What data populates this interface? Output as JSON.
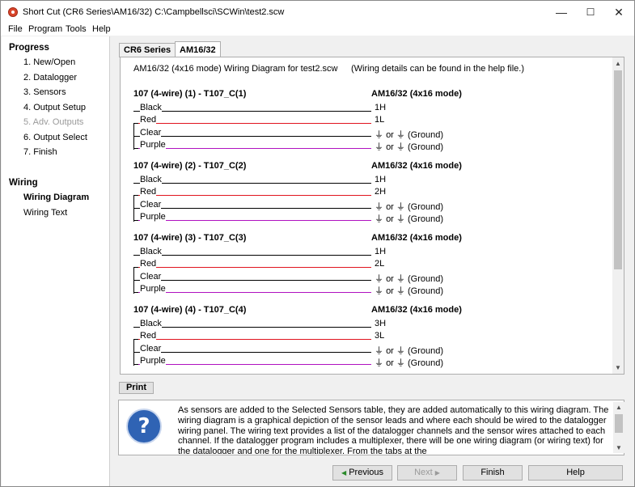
{
  "window": {
    "title": "Short Cut (CR6 Series\\AM16/32) C:\\Campbellsci\\SCWin\\test2.scw",
    "controls": {
      "minimize": "—",
      "maximize": "☐",
      "close": "✕"
    }
  },
  "menu": [
    "File",
    "Program",
    "Tools",
    "Help"
  ],
  "sidebar": {
    "progress_heading": "Progress",
    "progress_items": [
      {
        "label": "1. New/Open",
        "state": "normal"
      },
      {
        "label": "2. Datalogger",
        "state": "normal"
      },
      {
        "label": "3. Sensors",
        "state": "normal"
      },
      {
        "label": "4. Output Setup",
        "state": "normal"
      },
      {
        "label": "5. Adv. Outputs",
        "state": "disabled"
      },
      {
        "label": "6. Output Select",
        "state": "normal"
      },
      {
        "label": "7. Finish",
        "state": "normal"
      }
    ],
    "wiring_heading": "Wiring",
    "wiring_items": [
      {
        "label": "Wiring Diagram",
        "state": "active"
      },
      {
        "label": "Wiring Text",
        "state": "normal"
      }
    ]
  },
  "tabs": [
    {
      "label": "CR6 Series",
      "active": false
    },
    {
      "label": "AM16/32",
      "active": true
    }
  ],
  "diagram": {
    "header": "AM16/32 (4x16 mode) Wiring Diagram for test2.scw",
    "note": "(Wiring details can be found in the help file.)",
    "ground_or": "or",
    "ground_suffix": "(Ground)",
    "sensors": [
      {
        "title": "107 (4-wire) (1) - T107_C(1)",
        "mux": "AM16/32 (4x16 mode)",
        "wires": [
          {
            "label": "Black",
            "color": "#000000",
            "channel": "1H"
          },
          {
            "label": "Red",
            "color": "#e0141e",
            "channel": "1L"
          },
          {
            "label": "Clear",
            "color": "#000000",
            "channel": "ground"
          },
          {
            "label": "Purple",
            "color": "#b012c0",
            "channel": "ground"
          }
        ]
      },
      {
        "title": "107 (4-wire) (2) - T107_C(2)",
        "mux": "AM16/32 (4x16 mode)",
        "wires": [
          {
            "label": "Black",
            "color": "#000000",
            "channel": "1H"
          },
          {
            "label": "Red",
            "color": "#e0141e",
            "channel": "2H"
          },
          {
            "label": "Clear",
            "color": "#000000",
            "channel": "ground"
          },
          {
            "label": "Purple",
            "color": "#b012c0",
            "channel": "ground"
          }
        ]
      },
      {
        "title": "107 (4-wire) (3) - T107_C(3)",
        "mux": "AM16/32 (4x16 mode)",
        "wires": [
          {
            "label": "Black",
            "color": "#000000",
            "channel": "1H"
          },
          {
            "label": "Red",
            "color": "#e0141e",
            "channel": "2L"
          },
          {
            "label": "Clear",
            "color": "#000000",
            "channel": "ground"
          },
          {
            "label": "Purple",
            "color": "#b012c0",
            "channel": "ground"
          }
        ]
      },
      {
        "title": "107 (4-wire) (4) - T107_C(4)",
        "mux": "AM16/32 (4x16 mode)",
        "wires": [
          {
            "label": "Black",
            "color": "#000000",
            "channel": "3H"
          },
          {
            "label": "Red",
            "color": "#e0141e",
            "channel": "3L"
          },
          {
            "label": "Clear",
            "color": "#000000",
            "channel": "ground"
          },
          {
            "label": "Purple",
            "color": "#b012c0",
            "channel": "ground"
          }
        ]
      }
    ]
  },
  "print_label": "Print",
  "help_text": "As sensors are added to the Selected Sensors table, they are added automatically to this wiring diagram. The wiring diagram is a graphical depiction of the sensor leads and where each should be wired to the datalogger wiring panel. The wiring text provides a list of the datalogger channels and the sensor wires attached to each channel. If the datalogger program includes a multiplexer, there will be one wiring diagram (or wiring text) for the datalogger and one for the multiplexer. From the tabs at the",
  "nav": {
    "previous": "Previous",
    "next": "Next",
    "finish": "Finish",
    "help": "Help"
  }
}
